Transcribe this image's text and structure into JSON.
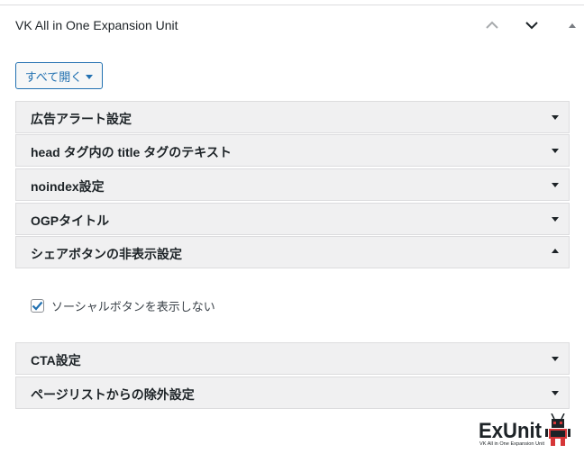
{
  "panel": {
    "title": "VK All in One Expansion Unit",
    "expand_all_label": "すべて開く"
  },
  "sections": [
    {
      "label": "広告アラート設定",
      "open": false
    },
    {
      "label": "head タグ内の title タグのテキスト",
      "open": false
    },
    {
      "label": "noindex設定",
      "open": false
    },
    {
      "label": "OGPタイトル",
      "open": false
    },
    {
      "label": "シェアボタンの非表示設定",
      "open": true
    },
    {
      "label": "CTA設定",
      "open": false
    },
    {
      "label": "ページリストからの除外設定",
      "open": false
    }
  ],
  "share_hide": {
    "checkbox_label": "ソーシャルボタンを表示しない",
    "checked": true
  },
  "logo": {
    "text": "ExUnit",
    "subtitle": "VK All in One Expansion Unit"
  },
  "colors": {
    "accent": "#2271b1",
    "section_bg": "#f0f0f1",
    "logo_red": "#d63638"
  }
}
